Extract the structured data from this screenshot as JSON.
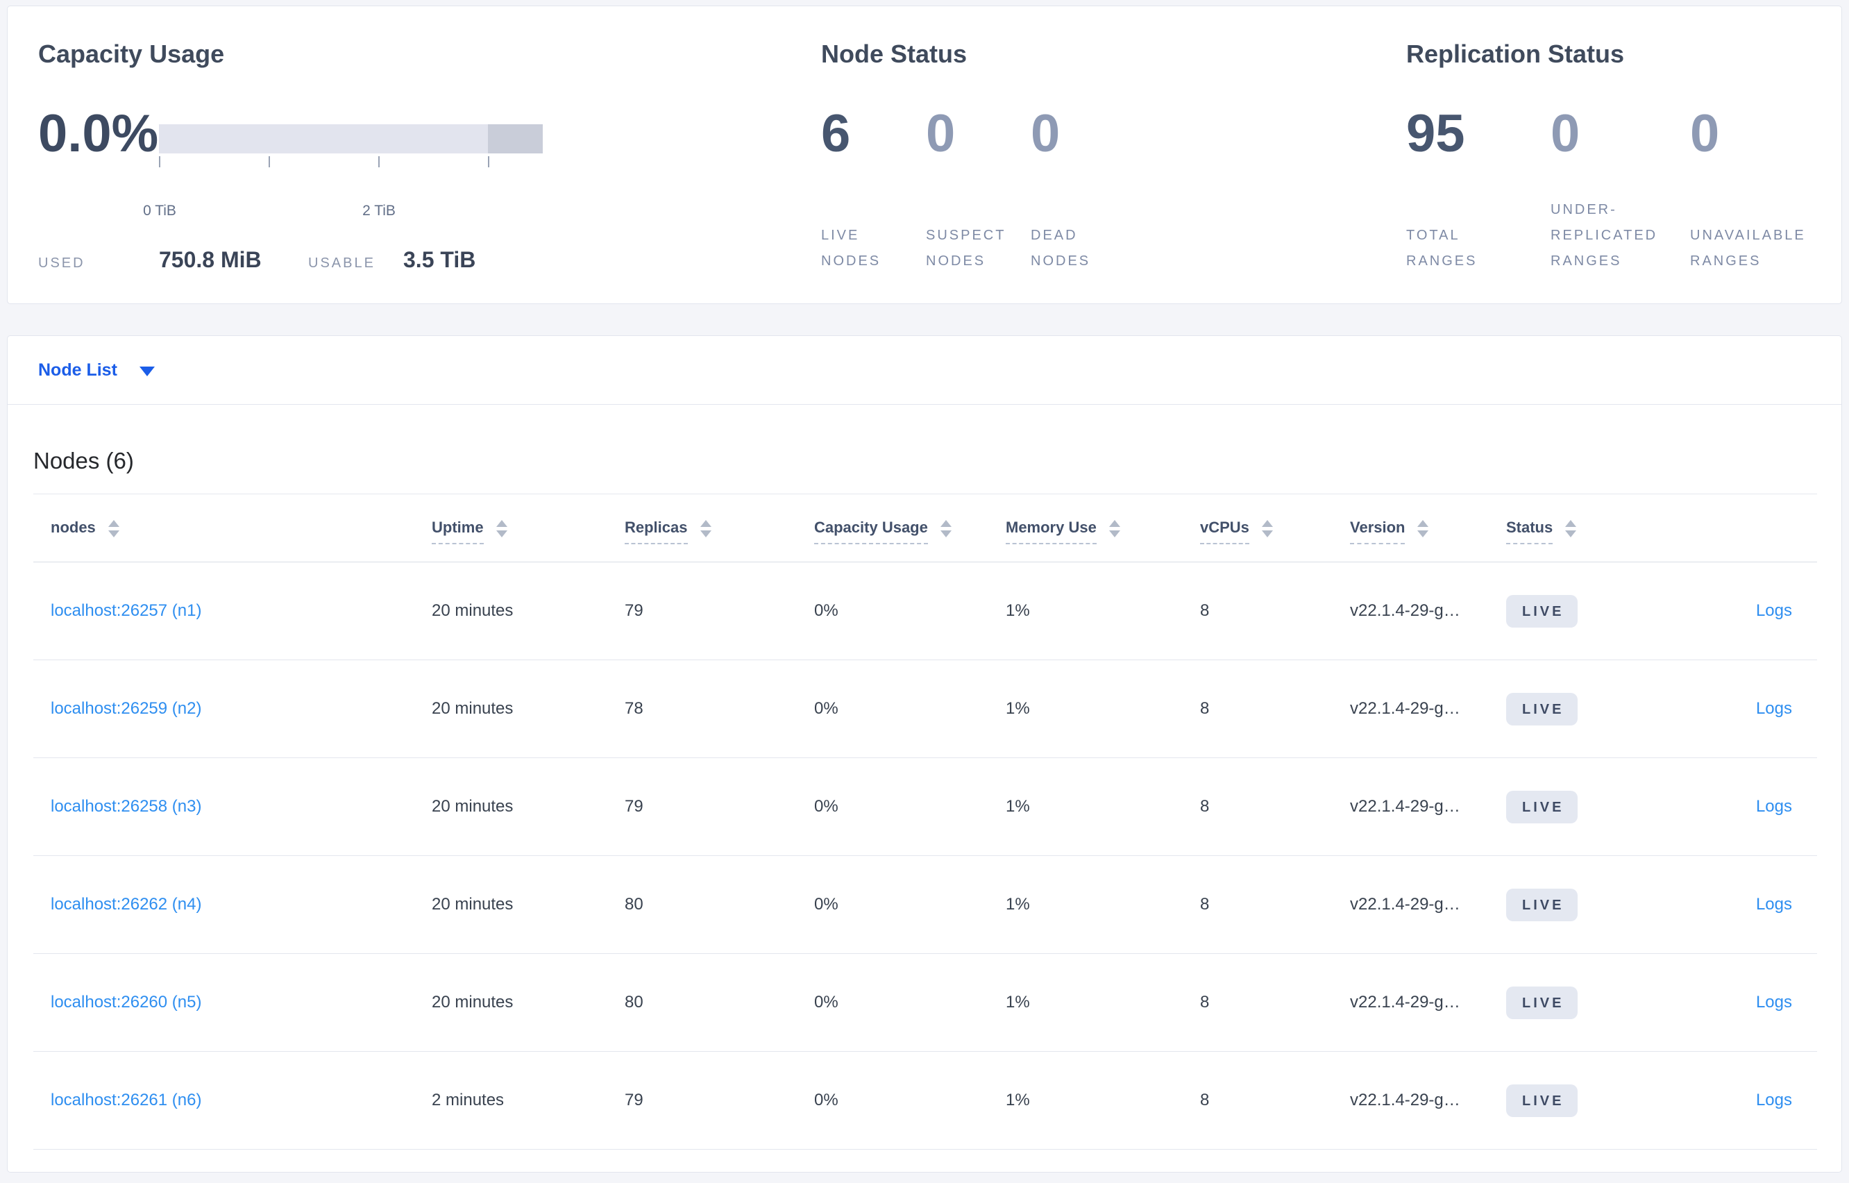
{
  "colors": {
    "page_background": "#f4f5f9",
    "primary_link_blue": "#1b5de8",
    "row_link_blue": "#2e8ef0",
    "capacity_bar_light": "#e2e4ee",
    "capacity_bar_dark": "#c9cdd9",
    "status_badge_background": "#e4e8f1",
    "stat_number_dark": "#47566f",
    "stat_number_muted": "#8e9ab4"
  },
  "summary": {
    "capacity": {
      "title": "Capacity Usage",
      "percent": "0.0%",
      "axis": {
        "total_tib": 3.5,
        "dark_segment_start_tib": 3.0,
        "tick_values": [
          0,
          1,
          2,
          3
        ],
        "tick_labels": [
          "0 TiB",
          "",
          "2 TiB",
          ""
        ]
      },
      "used_label": "USED",
      "used_value": "750.8 MiB",
      "usable_label": "USABLE",
      "usable_value": "3.5 TiB"
    },
    "node_status": {
      "title": "Node Status",
      "stats": [
        {
          "value": "6",
          "lines": [
            "LIVE",
            "NODES"
          ],
          "emphasis": true
        },
        {
          "value": "0",
          "lines": [
            "SUSPECT",
            "NODES"
          ],
          "emphasis": false
        },
        {
          "value": "0",
          "lines": [
            "DEAD",
            "NODES"
          ],
          "emphasis": false
        }
      ]
    },
    "replication_status": {
      "title": "Replication Status",
      "stats": [
        {
          "value": "95",
          "lines": [
            "TOTAL",
            "RANGES"
          ],
          "emphasis": true
        },
        {
          "value": "0",
          "lines": [
            "UNDER-",
            "REPLICATED",
            "RANGES"
          ],
          "emphasis": false
        },
        {
          "value": "0",
          "lines": [
            "UNAVAILABLE",
            "RANGES"
          ],
          "emphasis": false
        }
      ]
    }
  },
  "node_list": {
    "selector_label": "Node List",
    "heading": "Nodes (6)",
    "columns": [
      {
        "label": "nodes",
        "sortable": true,
        "underline": false
      },
      {
        "label": "Uptime",
        "sortable": true,
        "underline": true
      },
      {
        "label": "Replicas",
        "sortable": true,
        "underline": true
      },
      {
        "label": "Capacity Usage",
        "sortable": true,
        "underline": true
      },
      {
        "label": "Memory Use",
        "sortable": true,
        "underline": true
      },
      {
        "label": "vCPUs",
        "sortable": true,
        "underline": true
      },
      {
        "label": "Version",
        "sortable": true,
        "underline": true
      },
      {
        "label": "Status",
        "sortable": true,
        "underline": true
      },
      {
        "label": "",
        "sortable": false,
        "underline": false
      }
    ],
    "rows": [
      {
        "node": "localhost:26257 (n1)",
        "uptime": "20 minutes",
        "replicas": "79",
        "capacity": "0%",
        "memory": "1%",
        "vcpus": "8",
        "version": "v22.1.4-29-g…",
        "status": "LIVE",
        "logs": "Logs"
      },
      {
        "node": "localhost:26259 (n2)",
        "uptime": "20 minutes",
        "replicas": "78",
        "capacity": "0%",
        "memory": "1%",
        "vcpus": "8",
        "version": "v22.1.4-29-g…",
        "status": "LIVE",
        "logs": "Logs"
      },
      {
        "node": "localhost:26258 (n3)",
        "uptime": "20 minutes",
        "replicas": "79",
        "capacity": "0%",
        "memory": "1%",
        "vcpus": "8",
        "version": "v22.1.4-29-g…",
        "status": "LIVE",
        "logs": "Logs"
      },
      {
        "node": "localhost:26262 (n4)",
        "uptime": "20 minutes",
        "replicas": "80",
        "capacity": "0%",
        "memory": "1%",
        "vcpus": "8",
        "version": "v22.1.4-29-g…",
        "status": "LIVE",
        "logs": "Logs"
      },
      {
        "node": "localhost:26260 (n5)",
        "uptime": "20 minutes",
        "replicas": "80",
        "capacity": "0%",
        "memory": "1%",
        "vcpus": "8",
        "version": "v22.1.4-29-g…",
        "status": "LIVE",
        "logs": "Logs"
      },
      {
        "node": "localhost:26261 (n6)",
        "uptime": "2 minutes",
        "replicas": "79",
        "capacity": "0%",
        "memory": "1%",
        "vcpus": "8",
        "version": "v22.1.4-29-g…",
        "status": "LIVE",
        "logs": "Logs"
      }
    ]
  }
}
